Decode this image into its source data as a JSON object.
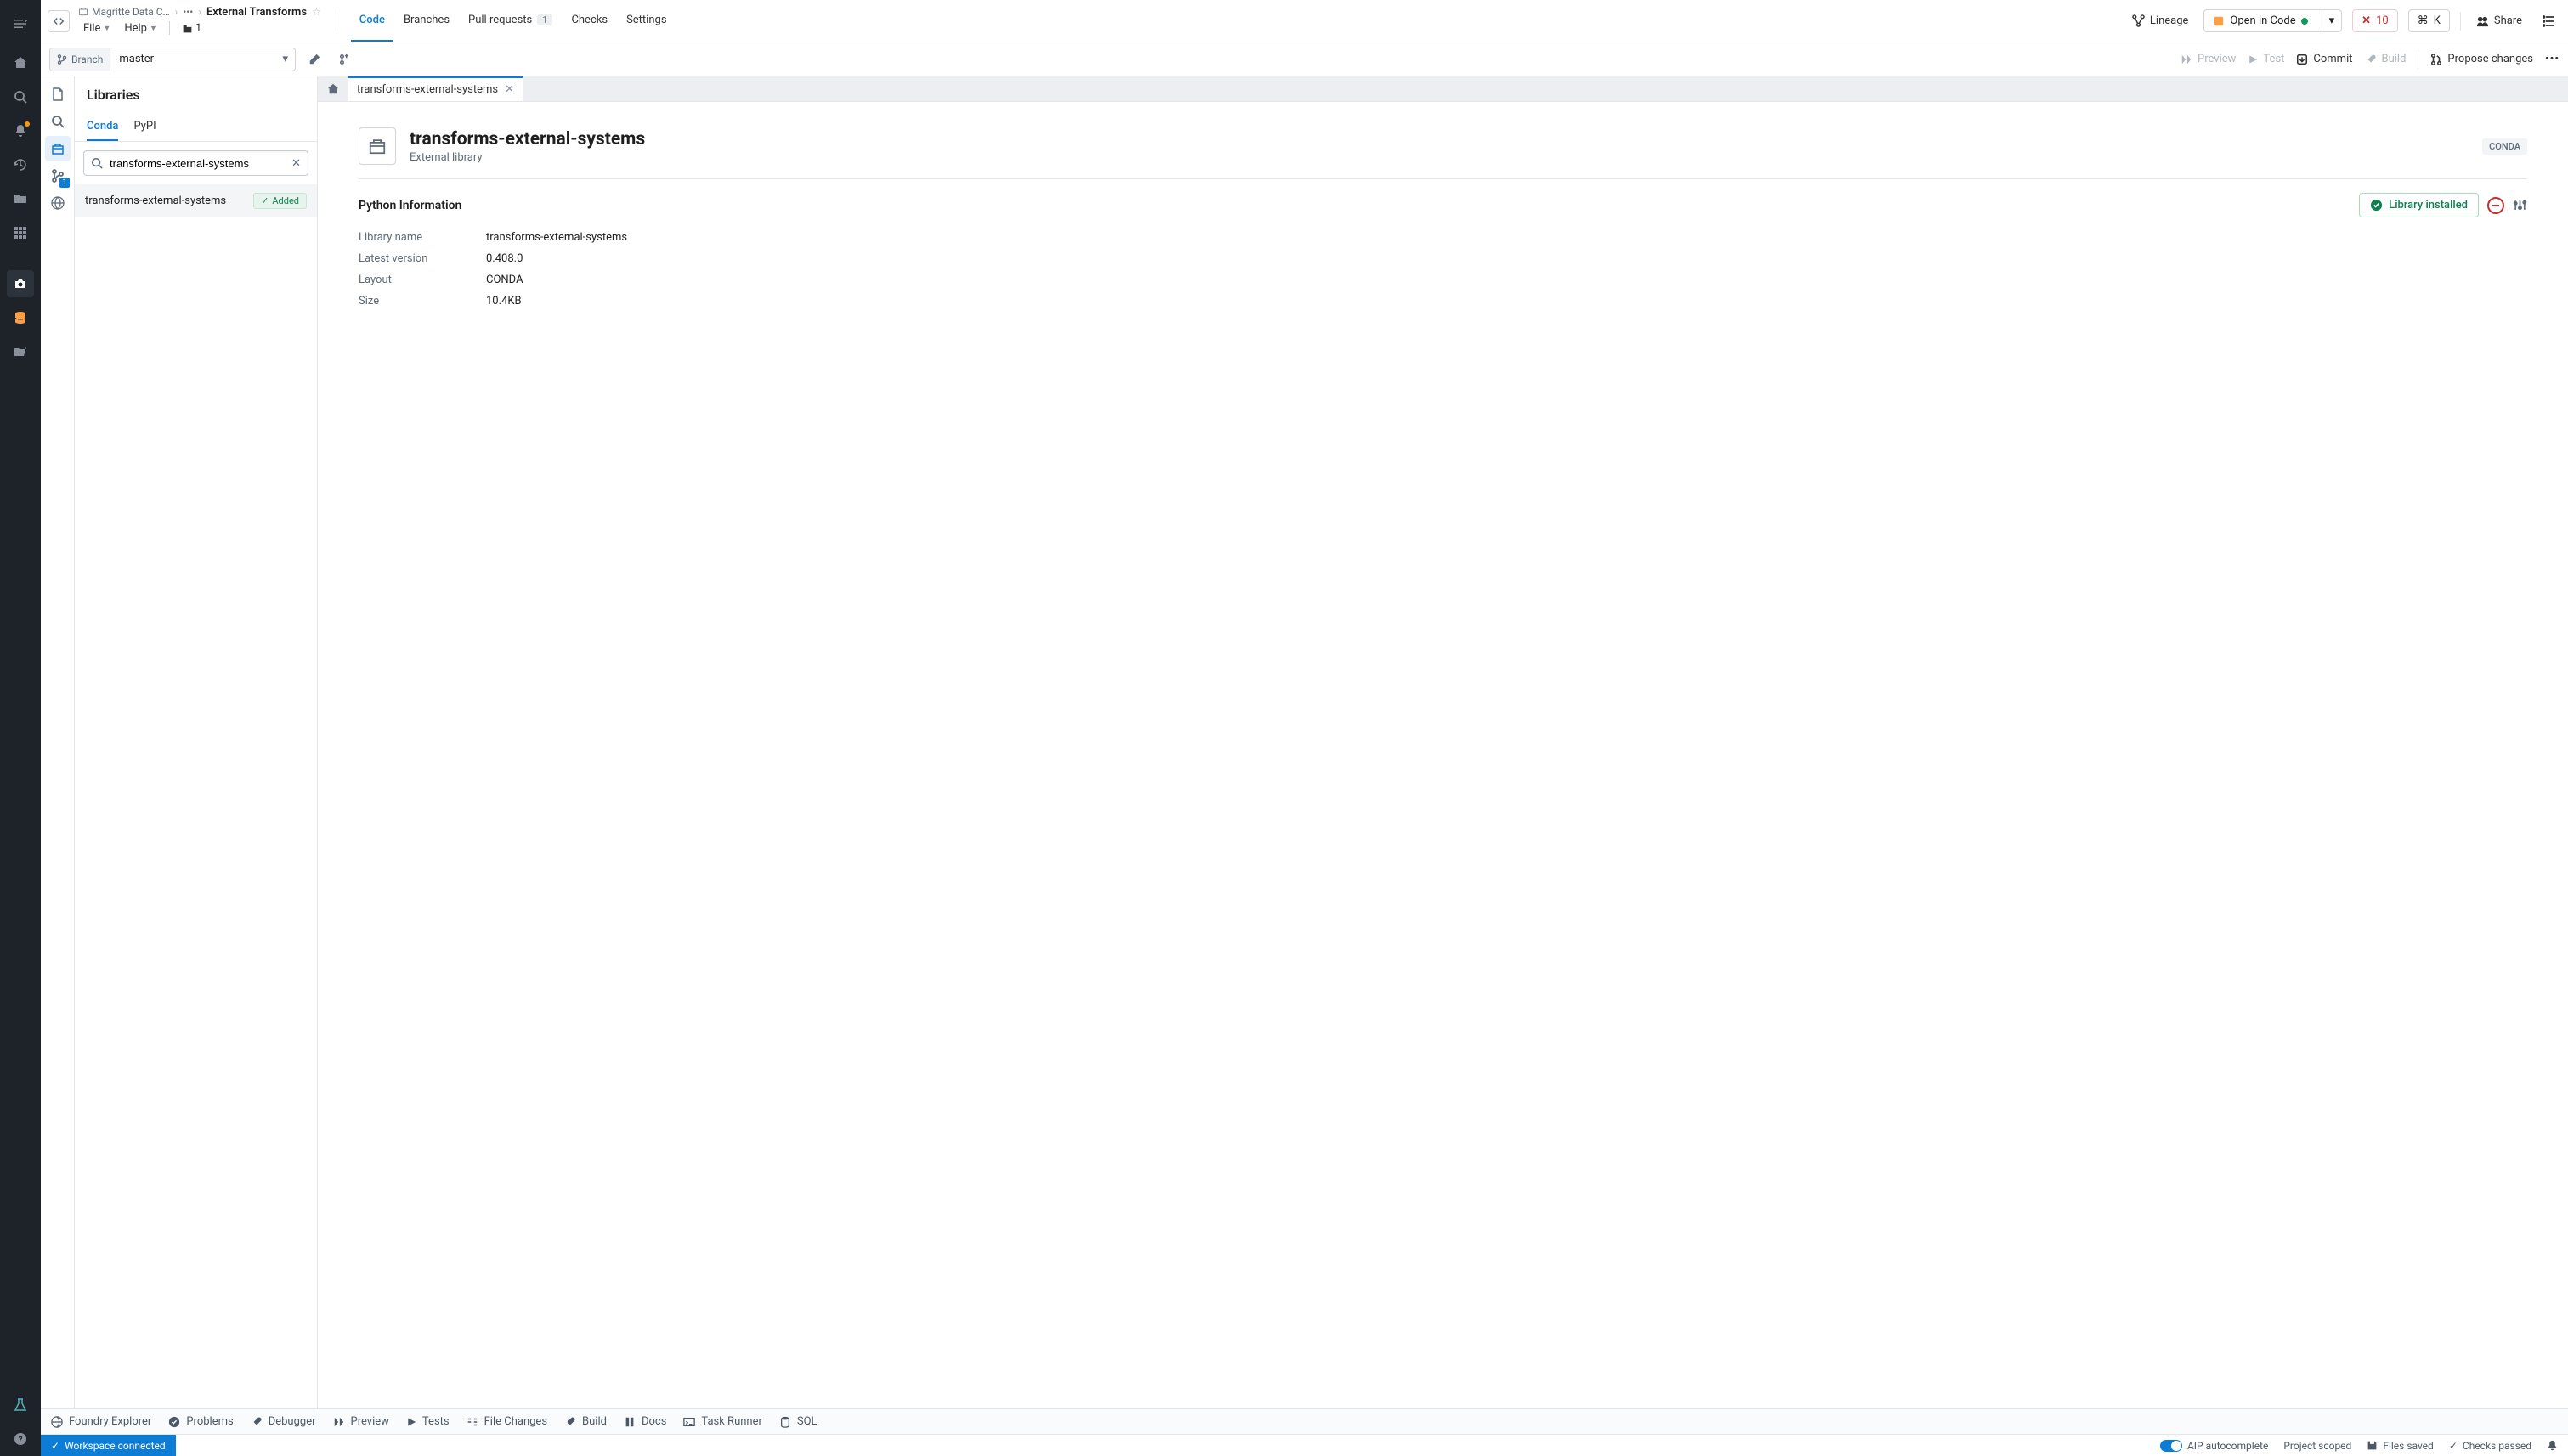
{
  "breadcrumb": {
    "root": "Magritte Data C…",
    "ellipsis": "•••",
    "current": "External Transforms"
  },
  "menus": {
    "file": "File",
    "help": "Help",
    "orgCount": "1"
  },
  "topTabs": {
    "code": "Code",
    "branches": "Branches",
    "pulls": "Pull requests",
    "pullsCount": "1",
    "checks": "Checks",
    "settings": "Settings"
  },
  "topActions": {
    "lineage": "Lineage",
    "openInCode": "Open in Code",
    "errCount": "10",
    "kbd": "K",
    "share": "Share"
  },
  "branch": {
    "label": "Branch",
    "value": "master"
  },
  "toolbar": {
    "preview": "Preview",
    "test": "Test",
    "commit": "Commit",
    "build": "Build",
    "propose": "Propose changes"
  },
  "libPanel": {
    "title": "Libraries",
    "tabs": {
      "conda": "Conda",
      "pypi": "PyPI"
    },
    "searchValue": "transforms-external-systems",
    "result": {
      "name": "transforms-external-systems",
      "added": "Added"
    }
  },
  "editorTab": "transforms-external-systems",
  "pkg": {
    "name": "transforms-external-systems",
    "subtitle": "External library",
    "badge": "CONDA",
    "infoHeader": "Python Information",
    "installed": "Library installed",
    "rows": {
      "libNameLabel": "Library name",
      "libName": "transforms-external-systems",
      "latestLabel": "Latest version",
      "latest": "0.408.0",
      "layoutLabel": "Layout",
      "layout": "CONDA",
      "sizeLabel": "Size",
      "size": "10.4KB"
    }
  },
  "bottom": {
    "foundry": "Foundry Explorer",
    "problems": "Problems",
    "debugger": "Debugger",
    "preview": "Preview",
    "tests": "Tests",
    "fileChanges": "File Changes",
    "build": "Build",
    "docs": "Docs",
    "taskRunner": "Task Runner",
    "sql": "SQL"
  },
  "status": {
    "ws": "Workspace connected",
    "aip": "AIP autocomplete",
    "scope": "Project scoped",
    "files": "Files saved",
    "checks": "Checks passed"
  },
  "toolStrip": {
    "branchBadge": "1"
  }
}
